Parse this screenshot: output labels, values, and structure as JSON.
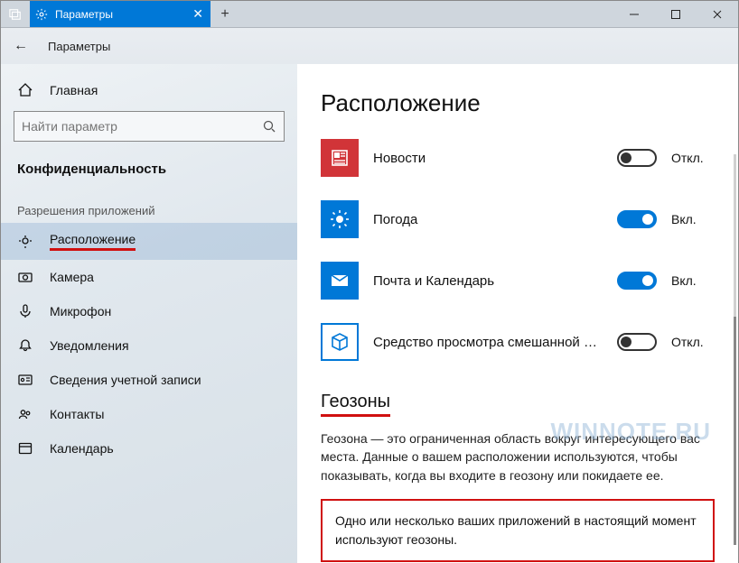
{
  "titlebar": {
    "tab_label": "Параметры",
    "close_glyph": "✕",
    "newtab_glyph": "+"
  },
  "crumb": {
    "back_glyph": "←",
    "label": "Параметры"
  },
  "sidebar": {
    "home": "Главная",
    "search_placeholder": "Найти параметр",
    "category": "Конфиденциальность",
    "section": "Разрешения приложений",
    "items": [
      {
        "label": "Расположение"
      },
      {
        "label": "Камера"
      },
      {
        "label": "Микрофон"
      },
      {
        "label": "Уведомления"
      },
      {
        "label": "Сведения учетной записи"
      },
      {
        "label": "Контакты"
      },
      {
        "label": "Календарь"
      }
    ]
  },
  "page": {
    "title": "Расположение",
    "apps": [
      {
        "name": "Новости",
        "state": "Откл.",
        "on": false,
        "tile": "red",
        "icon": "news"
      },
      {
        "name": "Погода",
        "state": "Вкл.",
        "on": true,
        "tile": "blue",
        "icon": "weather"
      },
      {
        "name": "Почта и Календарь",
        "state": "Вкл.",
        "on": true,
        "tile": "blue",
        "icon": "mail"
      },
      {
        "name": "Средство просмотра смешанной реальн...",
        "state": "Откл.",
        "on": false,
        "tile": "blue",
        "icon": "cube"
      }
    ],
    "geofence_title": "Геозоны",
    "geofence_desc": "Геозона — это ограниченная область вокруг интересующего вас места. Данные о вашем расположении используются, чтобы показывать, когда вы входите в геозону или покидаете ее.",
    "geofence_callout": "Одно или несколько ваших приложений в настоящий момент используют геозоны."
  },
  "watermark": "WINNOTE.RU"
}
